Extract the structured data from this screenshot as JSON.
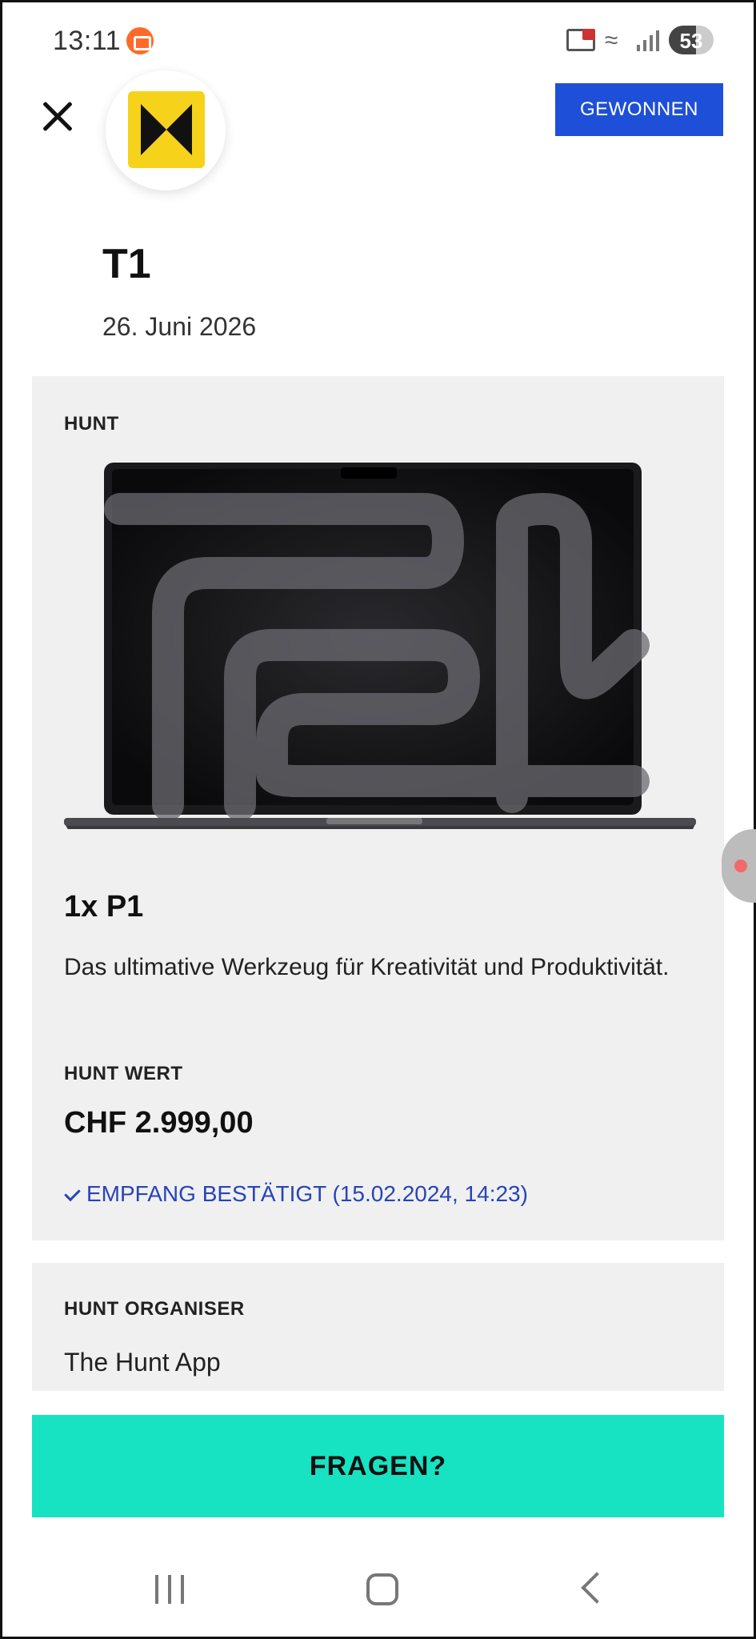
{
  "status_bar": {
    "time": "13:11",
    "battery": "53",
    "icons": [
      "notification-app-icon",
      "cast-icon",
      "wifi-icon",
      "signal-icon",
      "battery-icon"
    ]
  },
  "header": {
    "close_icon": "close-icon",
    "logo": "hunt-logo",
    "status_badge": "GEWONNEN",
    "badge_color": "#1e4fd8"
  },
  "hunt": {
    "title": "T1",
    "date": "26. Juni 2026"
  },
  "prize_card": {
    "section_label": "HUNT",
    "image": "laptop-image",
    "prize_name": "1x P1",
    "description": "Das ultimative Werkzeug für Kreativität und Produktivität.",
    "value_label": "HUNT WERT",
    "value": "CHF 2.999,00",
    "receipt_status": "EMPFANG BESTÄTIGT (15.02.2024, 14:23)",
    "receipt_color": "#2744b8"
  },
  "organiser_card": {
    "label": "HUNT ORGANISER",
    "name": "The Hunt App"
  },
  "cta": {
    "label": "FRAGEN?",
    "color": "#17e3c2"
  },
  "nav_bar": {
    "icons": [
      "recents-icon",
      "home-icon",
      "back-icon"
    ]
  }
}
